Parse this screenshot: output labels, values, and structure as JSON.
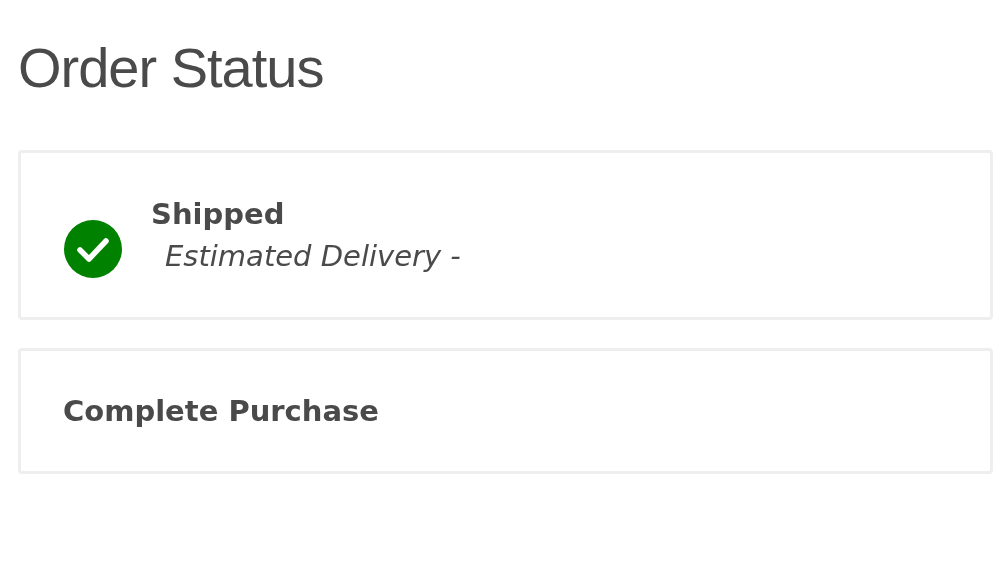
{
  "title": "Order Status",
  "steps": [
    {
      "label": "Shipped",
      "detail": "Estimated Delivery -",
      "completed": true
    },
    {
      "label": "Complete Purchase",
      "completed": false
    }
  ]
}
